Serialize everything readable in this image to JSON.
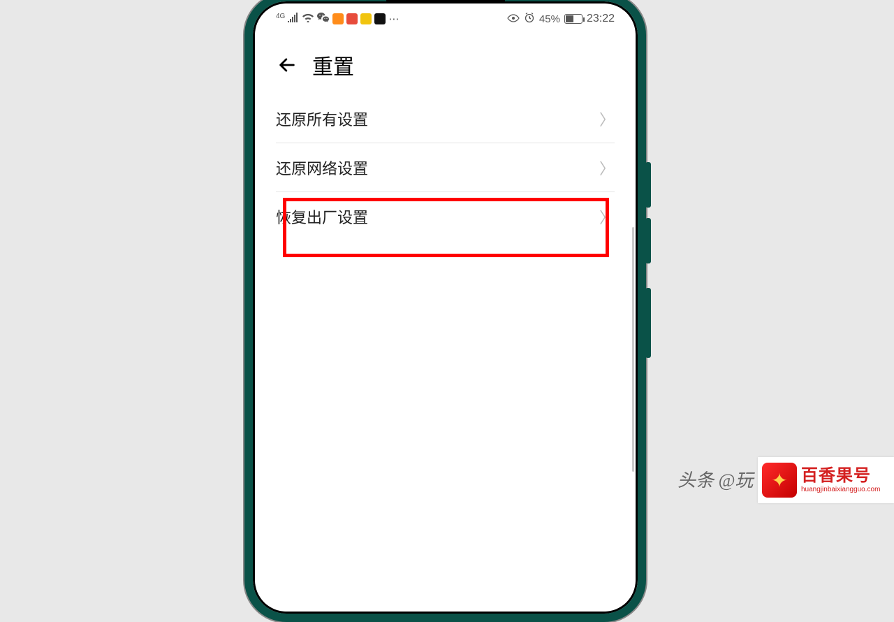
{
  "status": {
    "network_label": "4G",
    "battery_text": "45%",
    "time": "23:22"
  },
  "header": {
    "title": "重置"
  },
  "settings": {
    "items": [
      {
        "label": "还原所有设置",
        "highlighted": false
      },
      {
        "label": "还原网络设置",
        "highlighted": false
      },
      {
        "label": "恢复出厂设置",
        "highlighted": true
      }
    ]
  },
  "watermark": {
    "author_prefix": "头条 @玩",
    "site_title": "百香果号",
    "site_sub": "huangjinbaixiangguo.com"
  }
}
